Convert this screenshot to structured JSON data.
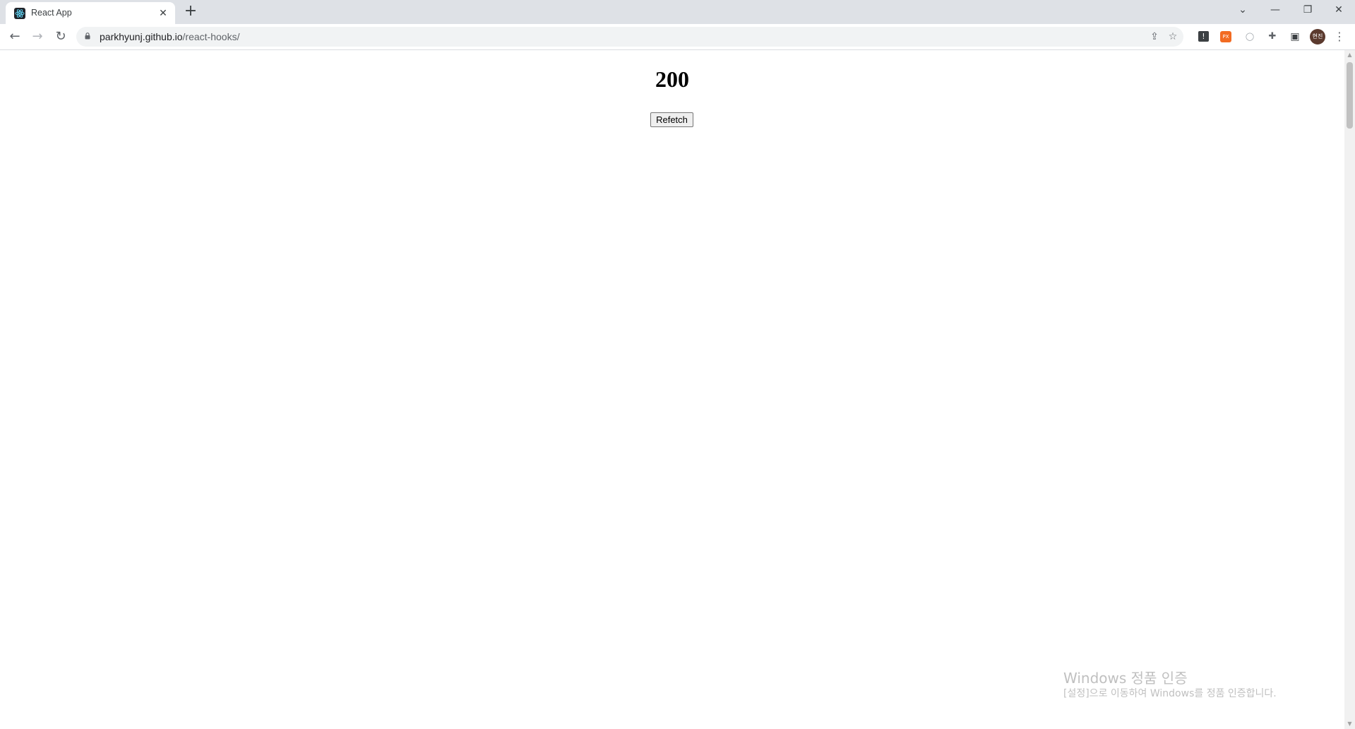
{
  "browser": {
    "tab": {
      "title": "React App",
      "close_glyph": "✕"
    },
    "new_tab_glyph": "+",
    "window_controls": {
      "tab_search_glyph": "⌄",
      "minimize_glyph": "—",
      "restore_glyph": "❐",
      "close_glyph": "✕"
    },
    "nav": {
      "back_glyph": "←",
      "forward_glyph": "→",
      "reload_glyph": "↻"
    },
    "address": {
      "host": "parkhyunj.github.io",
      "path": "/react-hooks/"
    },
    "omnibox_actions": {
      "share_glyph": "⇪",
      "bookmark_glyph": "☆"
    },
    "extensions": [
      {
        "icon": "extension-black-icon",
        "glyph": "!"
      },
      {
        "icon": "extension-orange-icon",
        "glyph": "PX"
      },
      {
        "icon": "extension-circle-icon",
        "glyph": "◯"
      },
      {
        "icon": "puzzle-icon",
        "glyph": "✚"
      },
      {
        "icon": "side-panel-icon",
        "glyph": "▣"
      }
    ],
    "profile_avatar_text": "현진",
    "menu_glyph": "⋮"
  },
  "page": {
    "status_code": "200",
    "refetch_label": "Refetch"
  },
  "watermark": {
    "title": "Windows 정품 인증",
    "subtitle": "[설정]으로 이동하여 Windows를 정품 인증합니다."
  },
  "colors": {
    "tabstrip": "#dee1e6",
    "omnibox": "#f1f3f4",
    "ext_orange": "#f26b22",
    "ext_black": "#3c4043"
  }
}
